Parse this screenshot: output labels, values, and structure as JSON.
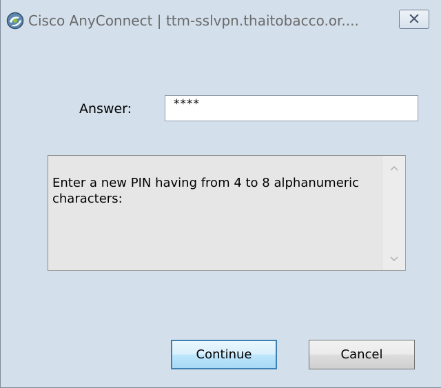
{
  "window": {
    "title": "Cisco AnyConnect | ttm-sslvpn.thaitobacco.or....",
    "icons": {
      "app": "anyconnect-globe-icon",
      "close": "close-icon"
    }
  },
  "form": {
    "answer_label": "Answer:",
    "answer_value": "****"
  },
  "message": {
    "text": "Enter a new PIN having from 4 to 8 alphanumeric characters:"
  },
  "buttons": {
    "continue_label": "Continue",
    "cancel_label": "Cancel"
  },
  "colors": {
    "window_background": "#d3dfeb",
    "message_background": "#e6e6e6",
    "default_button_border": "#3c7fb1"
  }
}
